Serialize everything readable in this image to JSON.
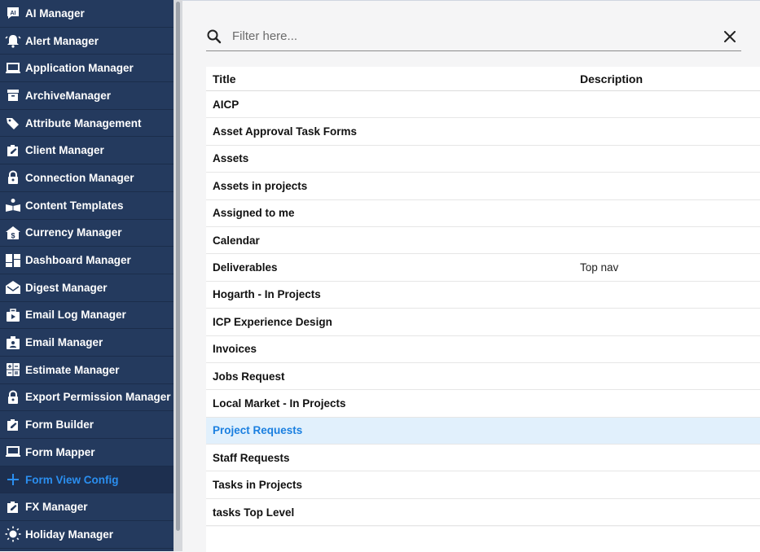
{
  "sidebar": {
    "items": [
      {
        "label": "AI Manager",
        "icon": "ai-icon"
      },
      {
        "label": "Alert Manager",
        "icon": "bell-icon"
      },
      {
        "label": "Application Manager",
        "icon": "laptop-icon"
      },
      {
        "label": "ArchiveManager",
        "icon": "archive-icon"
      },
      {
        "label": "Attribute Management",
        "icon": "tag-icon"
      },
      {
        "label": "Client Manager",
        "icon": "edit-doc-icon"
      },
      {
        "label": "Connection Manager",
        "icon": "lock-icon"
      },
      {
        "label": "Content Templates",
        "icon": "reader-icon"
      },
      {
        "label": "Currency Manager",
        "icon": "dollar-house-icon"
      },
      {
        "label": "Dashboard Manager",
        "icon": "dashboard-icon"
      },
      {
        "label": "Digest Manager",
        "icon": "mail-open-icon"
      },
      {
        "label": "Email Log Manager",
        "icon": "play-case-icon"
      },
      {
        "label": "Email Manager",
        "icon": "contact-badge-icon"
      },
      {
        "label": "Estimate Manager",
        "icon": "calculator-icon"
      },
      {
        "label": "Export Permission Manager",
        "icon": "lock-icon"
      },
      {
        "label": "Form Builder",
        "icon": "edit-doc-icon"
      },
      {
        "label": "Form Mapper",
        "icon": "laptop-icon"
      },
      {
        "label": "Form View Config",
        "icon": "plus-icon",
        "active": true
      },
      {
        "label": "FX Manager",
        "icon": "edit-doc-icon"
      },
      {
        "label": "Holiday Manager",
        "icon": "sun-icon"
      }
    ]
  },
  "filter": {
    "placeholder": "Filter here...",
    "value": ""
  },
  "table": {
    "columns": [
      "Title",
      "Description"
    ],
    "rows": [
      {
        "title": "AICP",
        "description": ""
      },
      {
        "title": "Asset Approval Task Forms",
        "description": ""
      },
      {
        "title": "Assets",
        "description": ""
      },
      {
        "title": "Assets in projects",
        "description": ""
      },
      {
        "title": "Assigned to me",
        "description": ""
      },
      {
        "title": "Calendar",
        "description": ""
      },
      {
        "title": "Deliverables",
        "description": "Top nav"
      },
      {
        "title": "Hogarth - In Projects",
        "description": ""
      },
      {
        "title": "ICP Experience Design",
        "description": ""
      },
      {
        "title": "Invoices",
        "description": ""
      },
      {
        "title": "Jobs Request",
        "description": ""
      },
      {
        "title": "Local Market - In Projects",
        "description": ""
      },
      {
        "title": "Project Requests",
        "description": "",
        "selected": true
      },
      {
        "title": "Staff Requests",
        "description": ""
      },
      {
        "title": "Tasks in Projects",
        "description": ""
      },
      {
        "title": "tasks Top Level",
        "description": ""
      }
    ]
  },
  "colors": {
    "sidebar_bg": "#243a5e",
    "active_text": "#2b8ff0",
    "selected_row_bg": "#e1f0fc",
    "selected_row_text": "#1a7fe0"
  }
}
